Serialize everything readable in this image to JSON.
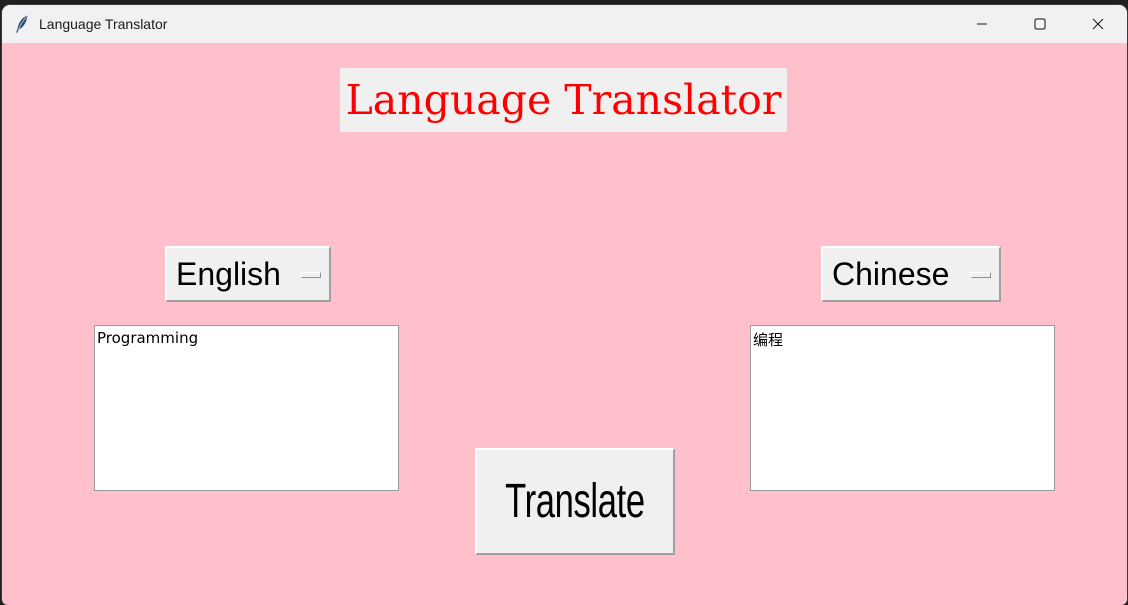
{
  "window": {
    "title": "Language Translator",
    "icon": "feather-icon",
    "controls": [
      "minimize-icon",
      "maximize-icon",
      "close-icon"
    ]
  },
  "heading": {
    "text": "Language Translator",
    "color": "#ff0000"
  },
  "source": {
    "language": "English",
    "text": "Programming"
  },
  "target": {
    "language": "Chinese",
    "text": "编程"
  },
  "translate_button": {
    "label": "Translate"
  },
  "colors": {
    "background": "#ffc0cb",
    "widget": "#f0f0f0"
  }
}
